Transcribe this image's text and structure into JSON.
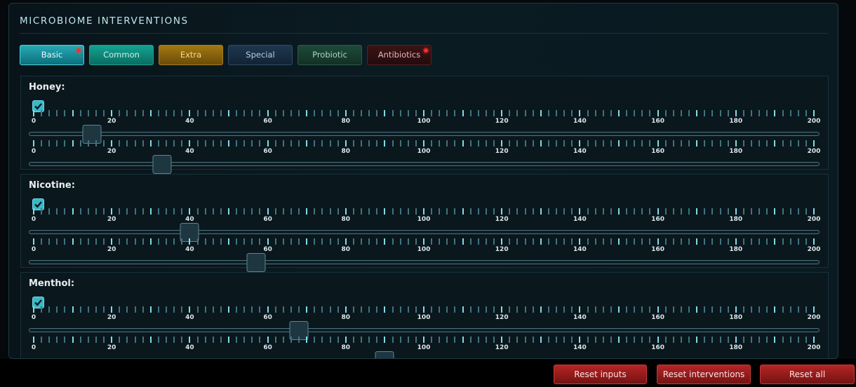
{
  "panel": {
    "title": "MICROBIOME INTERVENTIONS"
  },
  "tabs": [
    {
      "label": "Basic",
      "key": "basic",
      "active": true,
      "alert": true
    },
    {
      "label": "Common",
      "key": "common",
      "active": false,
      "alert": false
    },
    {
      "label": "Extra",
      "key": "extra",
      "active": false,
      "alert": false
    },
    {
      "label": "Special",
      "key": "special",
      "active": false,
      "alert": false
    },
    {
      "label": "Probiotic",
      "key": "probiotic",
      "active": false,
      "alert": false
    },
    {
      "label": "Antibiotics",
      "key": "antibiotics",
      "active": false,
      "alert": true
    }
  ],
  "scale": {
    "min": 0,
    "max": 200,
    "labels": [
      "0",
      "20",
      "40",
      "60",
      "80",
      "100",
      "120",
      "140",
      "160",
      "180",
      "200"
    ]
  },
  "sections": [
    {
      "label": "Honey:",
      "checked": true,
      "sliders": [
        15,
        33
      ]
    },
    {
      "label": "Nicotine:",
      "checked": true,
      "sliders": [
        40,
        57
      ]
    },
    {
      "label": "Menthol:",
      "checked": true,
      "sliders": [
        68,
        90
      ]
    }
  ],
  "actions": {
    "reset_inputs": "Reset inputs",
    "reset_interventions": "Reset interventions",
    "reset_all": "Reset all"
  },
  "colors": {
    "accent": "#37b9c8",
    "alert": "#ff2a2a",
    "danger_button": "#b62424"
  }
}
